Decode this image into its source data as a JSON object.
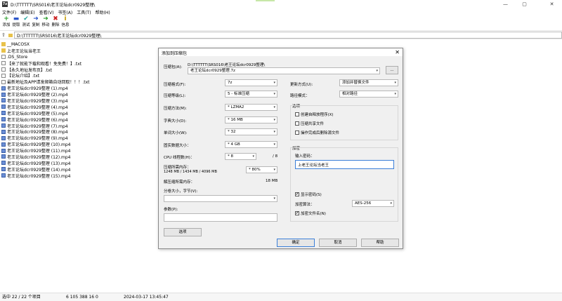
{
  "window": {
    "app_icon_text": "7z",
    "title": "D:\\TTTTTT\\SRS016\\老王论坛dcr0929整理\\",
    "minimize": "—",
    "maximize": "▢",
    "close": "✕"
  },
  "menu": [
    "文件(F)",
    "编辑(E)",
    "查看(V)",
    "书签(A)",
    "工具(T)",
    "帮助(H)"
  ],
  "toolbar": [
    {
      "label": "添加",
      "icon": "add-icon",
      "glyph": "+",
      "color": "#2a9d2a"
    },
    {
      "label": "提取",
      "icon": "extract-icon",
      "glyph": "▬",
      "color": "#2b55c9"
    },
    {
      "label": "测试",
      "icon": "test-icon",
      "glyph": "✔",
      "color": "#2aa7a0"
    },
    {
      "label": "复制",
      "icon": "copy-icon",
      "glyph": "➜",
      "color": "#2b55c9"
    },
    {
      "label": "移动",
      "icon": "move-icon",
      "glyph": "➜",
      "color": "#2a9d2a"
    },
    {
      "label": "删除",
      "icon": "delete-icon",
      "glyph": "✖",
      "color": "#cc2222"
    },
    {
      "label": "信息",
      "icon": "info-icon",
      "glyph": "i",
      "color": "#c49a00"
    }
  ],
  "address": {
    "path": "D:\\TTTTTT\\SRS016\\老王论坛dcr0929整理\\"
  },
  "files": [
    {
      "name": "__MACOSX",
      "type": "folder"
    },
    {
      "name": "上老王论坛当老王",
      "type": "folder"
    },
    {
      "name": ".DS_Store",
      "type": "doc"
    },
    {
      "name": "【来了就能下载和观看！免免费！】.txt",
      "type": "doc"
    },
    {
      "name": "【永久地址发布页】.txt",
      "type": "doc"
    },
    {
      "name": "【论坛介绍】.txt",
      "type": "doc"
    },
    {
      "name": "最新地址及APP请发邮箱自动回取！！！.txt",
      "type": "doc"
    },
    {
      "name": "老王论坛dcr0929整理 (1).mp4",
      "type": "video"
    },
    {
      "name": "老王论坛dcr0929整理 (2).mp4",
      "type": "video"
    },
    {
      "name": "老王论坛dcr0929整理 (3).mp4",
      "type": "video"
    },
    {
      "name": "老王论坛dcr0929整理 (4).mp4",
      "type": "video"
    },
    {
      "name": "老王论坛dcr0929整理 (5).mp4",
      "type": "video"
    },
    {
      "name": "老王论坛dcr0929整理 (6).mp4",
      "type": "video"
    },
    {
      "name": "老王论坛dcr0929整理 (7).mp4",
      "type": "video"
    },
    {
      "name": "老王论坛dcr0929整理 (8).mp4",
      "type": "video"
    },
    {
      "name": "老王论坛dcr0929整理 (9).mp4",
      "type": "video"
    },
    {
      "name": "老王论坛dcr0929整理 (10).mp4",
      "type": "video"
    },
    {
      "name": "老王论坛dcr0929整理 (11).mp4",
      "type": "video"
    },
    {
      "name": "老王论坛dcr0929整理 (12).mp4",
      "type": "video"
    },
    {
      "name": "老王论坛dcr0929整理 (13).mp4",
      "type": "video"
    },
    {
      "name": "老王论坛dcr0929整理 (14).mp4",
      "type": "video"
    },
    {
      "name": "老王论坛dcr0929整理 (15).mp4",
      "type": "video"
    }
  ],
  "status": {
    "selected": "选中 22 / 22 个项目",
    "size": "6 105 388 16 0",
    "date": "2024-03-17 13:45:47"
  },
  "dialog": {
    "title": "添加到压缩包",
    "close": "✕",
    "archive_label": "压缩包(A):",
    "archive_dir": "D:\\TTTTTT\\SRS016\\老王论坛dcr0929整理\\",
    "archive_name": "老王论坛dcr0929整理.7z",
    "browse": "...",
    "format_label": "压缩格式(F):",
    "format_value": "7z",
    "level_label": "压缩等级(L):",
    "level_value": "5 - 标准压缩",
    "method_label": "压缩方法(M):",
    "method_value": "* LZMA2",
    "dict_label": "字典大小(D):",
    "dict_value": "* 16 MB",
    "word_label": "单词大小(W):",
    "word_value": "* 32",
    "solid_label": "固实数据大小：",
    "solid_value": "* 4 GB",
    "threads_label": "CPU 线程数(H)：",
    "threads_value": "* 8",
    "threads_max": "/ 8",
    "mem_label": "压缩所需内存：",
    "mem_detail": "1248 MB / 1434 MB / 4096 MB",
    "mem_value": "* 80%",
    "decomp_label": "解压缩所需内存：",
    "decomp_value": "18 MB",
    "split_label": "分卷大小，字节(V):",
    "split_value": "",
    "params_label": "参数(P):",
    "params_value": "",
    "options_button": "选项",
    "update_label": "更新方式(U):",
    "update_value": "添加并替换文件",
    "path_label": "路径模式：",
    "path_value": "相对路径",
    "options_group": "选项",
    "opt_sfx": "创建自释放程序(X)",
    "opt_shared": "压缩共享文件",
    "opt_delete": "操作完成后删除源文件",
    "enc_group": "加密",
    "password_label": "输入密码：",
    "password_value": "上老王论坛当老王",
    "show_password": "显示密码(S)",
    "enc_method_label": "加密算法：",
    "enc_method_value": "AES-256",
    "enc_names": "加密文件名(N)",
    "ok": "确定",
    "cancel": "取消",
    "help": "帮助",
    "check_glyph": "✔"
  }
}
